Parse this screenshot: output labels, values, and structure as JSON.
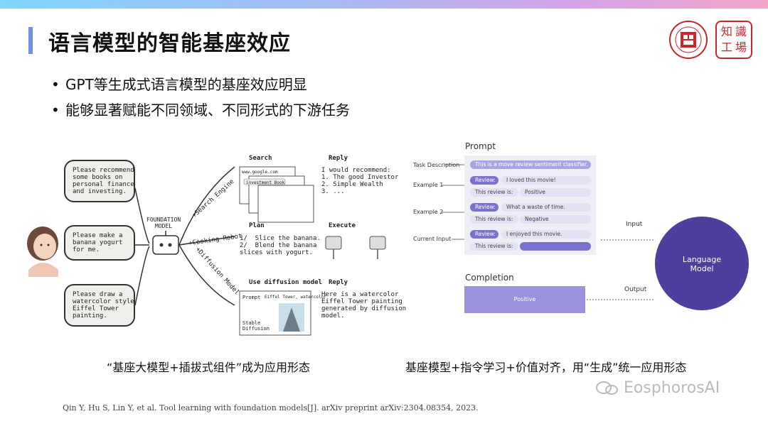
{
  "slide": {
    "title": "语言模型的智能基座效应",
    "bullets": [
      "GPT等生成式语言模型的基座效应明显",
      "能够显著赋能不同领域、不同形式的下游任务"
    ],
    "logo2_chars": [
      "知",
      "識",
      "工",
      "場"
    ],
    "caption_left": "“基座大模型+插拔式组件”成为应用形态",
    "caption_right": "基座模型+指令学习+价值对齐，用“生成”统一应用形态",
    "reference": "Qin Y, Hu S, Lin Y, et al. Tool learning with foundation models[J]. arXiv preprint arXiv:2304.08354, 2023.",
    "watermark": "EosphorosAI"
  },
  "left_figure": {
    "requests": [
      "Please recommend\nsome books on\npersonal finance\nand investing.",
      "Please make a\nbanana yogurt\nfor me.",
      "Please draw a\nwatercolor style\nEiffel Tower\npainting."
    ],
    "model_label": "FOUNDATION\nMODEL",
    "branches": [
      "+Search Engine",
      "+Cooking Robot",
      "+Diffusion Model"
    ],
    "search": {
      "head": "Search",
      "url": "www.google.com",
      "query": "investment Book"
    },
    "reply1": {
      "head": "Reply",
      "text": "I would recommend:\n1. The good Investor\n2. Simple Wealth\n3. ..."
    },
    "plan": {
      "head": "Plan",
      "text": "1/  Slice the banana.\n2/  Blend the banana\nslices with yogurt."
    },
    "execute": {
      "head": "Execute"
    },
    "diffusion": {
      "head": "Use diffusion model",
      "prompt_label": "Prompt",
      "prompt_value": "Eiffel Tower, watercolor",
      "model_name": "Stable\nDiffusion"
    },
    "reply2": {
      "head": "Reply",
      "text": "Here is a watercolor\nEiffel Tower painting\ngenerated by diffusion\nmodel."
    }
  },
  "right_figure": {
    "prompt_title": "Prompt",
    "completion_title": "Completion",
    "labels": [
      "Task Description",
      "Example 1",
      "Example 2",
      "Current Input"
    ],
    "task_description": "This is a move review sentiment classifier.",
    "review_tag": "Review:",
    "result_tag": "This review is:",
    "examples": [
      {
        "review": "I loved this movie!",
        "result": "Positive"
      },
      {
        "review": "What a waste of time.",
        "result": "Negative"
      },
      {
        "review": "I enjoyed this movie.",
        "result": ""
      }
    ],
    "input_label": "Input",
    "output_label": "Output",
    "model_label": "Language\nModel",
    "completion_value": "Positive"
  }
}
